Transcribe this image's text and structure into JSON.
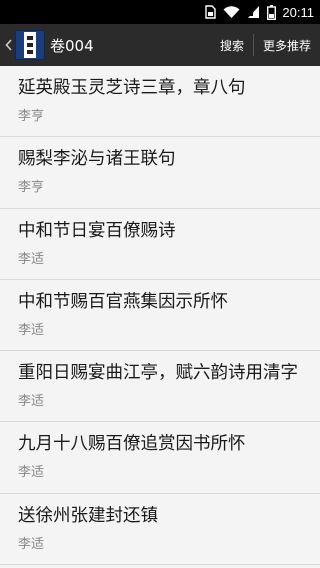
{
  "status": {
    "time": "20:11",
    "icons": [
      "sim-card-icon",
      "wifi-icon",
      "signal-icon",
      "battery-icon"
    ]
  },
  "toolbar": {
    "title": "卷004",
    "search_label": "搜索",
    "more_label": "更多推荐",
    "app_icon": "book-app-icon"
  },
  "poems": [
    {
      "title": "延英殿玉灵芝诗三章，章八句",
      "author": "李亨"
    },
    {
      "title": "赐梨李泌与诸王联句",
      "author": "李亨"
    },
    {
      "title": "中和节日宴百僚赐诗",
      "author": "李适"
    },
    {
      "title": "中和节赐百官燕集因示所怀",
      "author": "李适"
    },
    {
      "title": "重阳日赐宴曲江亭，赋六韵诗用清字",
      "author": "李适"
    },
    {
      "title": "九月十八赐百僚追赏因书所怀",
      "author": "李适"
    },
    {
      "title": "送徐州张建封还镇",
      "author": "李适"
    }
  ]
}
